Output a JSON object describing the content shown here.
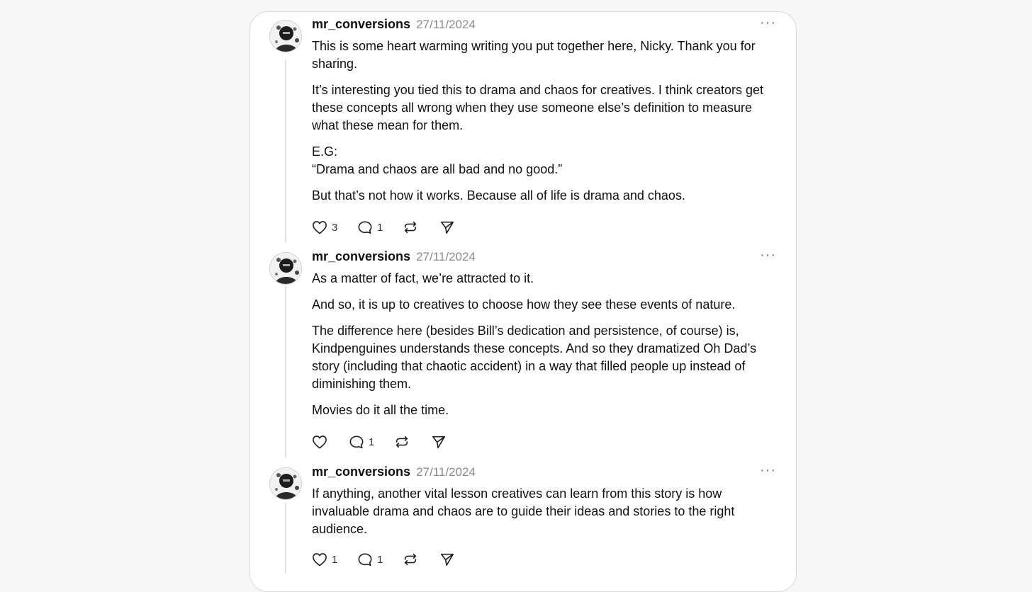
{
  "comments": [
    {
      "username": "mr_conversions",
      "date": "27/11/2024",
      "more": "···",
      "paragraphs": [
        "This is some heart warming writing you put together here, Nicky. Thank you for sharing.",
        "It’s interesting you tied this to drama and chaos for creatives. I think creators get these concepts all wrong when they use someone else’s definition to measure what these mean for them.",
        "E.G:",
        "“Drama and chaos are all bad and no good.”",
        "But that’s not how it works. Because all of life is drama and chaos."
      ],
      "likes": "3",
      "replies": "1"
    },
    {
      "username": "mr_conversions",
      "date": "27/11/2024",
      "more": "···",
      "paragraphs": [
        "As a matter of fact, we’re attracted to it.",
        "And so, it is up to creatives to choose how they see these events of nature.",
        "The difference here (besides Bill’s dedication and persistence, of course) is, Kindpenguines understands these concepts. And so they dramatized Oh Dad’s story (including that chaotic accident) in a way that filled people up instead of diminishing them.",
        "Movies do it all the time."
      ],
      "likes": "",
      "replies": "1"
    },
    {
      "username": "mr_conversions",
      "date": "27/11/2024",
      "more": "···",
      "paragraphs": [
        "If anything, another vital lesson creatives can learn from this story is how invaluable drama and chaos are to guide their ideas and stories to the right audience."
      ],
      "likes": "1",
      "replies": "1"
    }
  ],
  "icons": {
    "like": "heart-icon",
    "reply": "comment-bubble-icon",
    "restack": "restack-icon",
    "share": "share-send-icon",
    "more": "more-dots-icon"
  }
}
